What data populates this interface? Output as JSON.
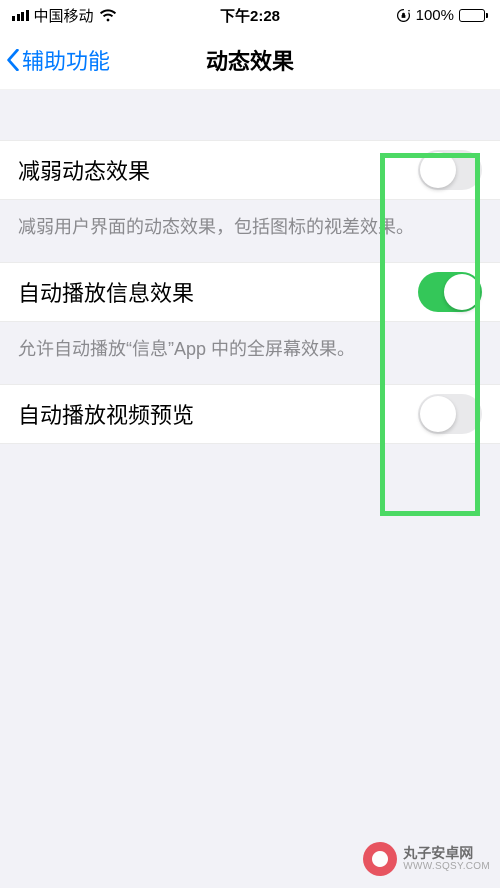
{
  "statusbar": {
    "carrier": "中国移动",
    "time": "下午2:28",
    "battery_pct": "100%"
  },
  "nav": {
    "back_label": "辅助功能",
    "title": "动态效果"
  },
  "settings": {
    "reduce_motion": {
      "label": "减弱动态效果",
      "on": false,
      "desc": "减弱用户界面的动态效果，包括图标的视差效果。"
    },
    "autoplay_msg": {
      "label": "自动播放信息效果",
      "on": true,
      "desc": "允许自动播放“信息”App 中的全屏幕效果。"
    },
    "autoplay_video": {
      "label": "自动播放视频预览",
      "on": false
    }
  },
  "watermark": {
    "brand": "丸子安卓网",
    "url": "WWW.SQSY.COM"
  }
}
